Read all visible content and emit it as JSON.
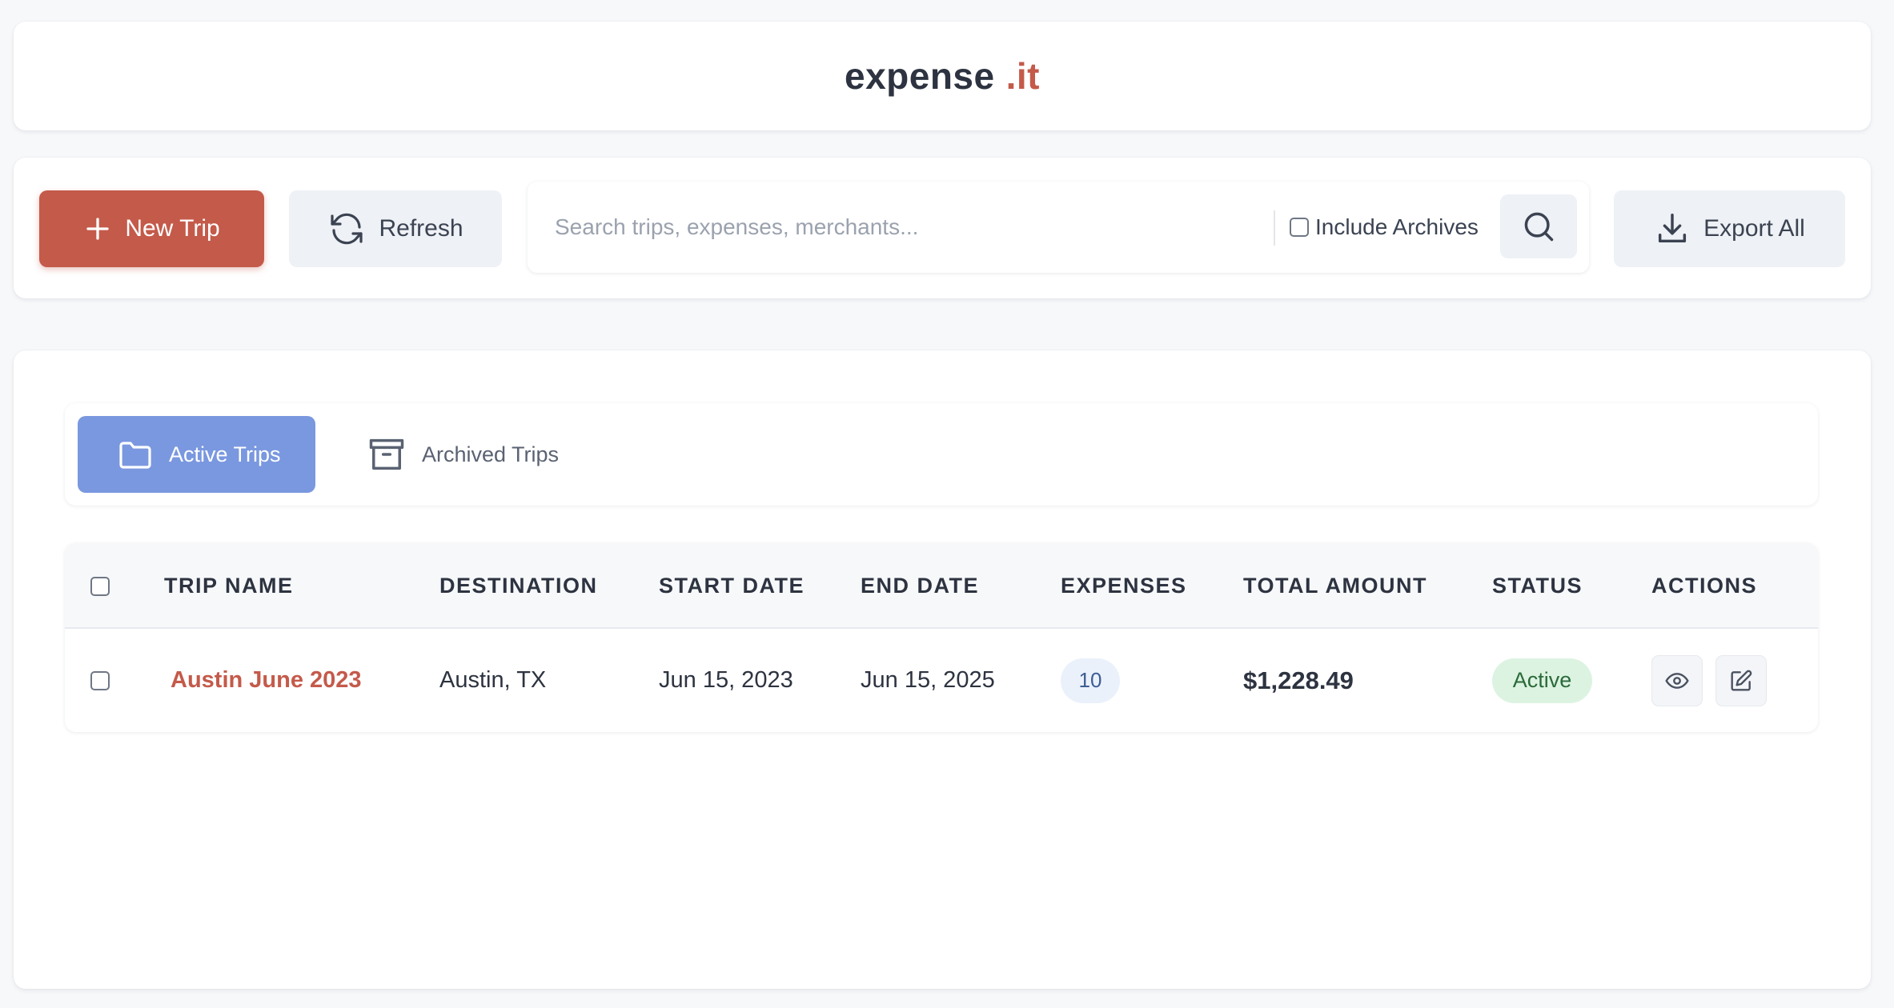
{
  "app": {
    "brand_name": "expense",
    "brand_tld": ".it",
    "accent_color": "#c45a4a"
  },
  "toolbar": {
    "new_trip_label": "New Trip",
    "refresh_label": "Refresh",
    "search_placeholder": "Search trips, expenses, merchants...",
    "search_value": "",
    "include_archives_label": "Include Archives",
    "include_archives_checked": false,
    "export_label": "Export All"
  },
  "tabs": [
    {
      "label": "Active Trips",
      "active": true,
      "icon": "folder-icon"
    },
    {
      "label": "Archived Trips",
      "active": false,
      "icon": "archive-icon"
    }
  ],
  "table": {
    "columns": [
      "TRIP NAME",
      "DESTINATION",
      "START DATE",
      "END DATE",
      "EXPENSES",
      "TOTAL AMOUNT",
      "STATUS",
      "ACTIONS"
    ],
    "rows": [
      {
        "trip_name": "Austin June 2023",
        "destination": "Austin, TX",
        "start_date": "Jun 15, 2023",
        "end_date": "Jun 15, 2025",
        "expenses": "10",
        "total_amount": "$1,228.49",
        "status": "Active",
        "actions": [
          "eye-icon",
          "edit-icon"
        ]
      }
    ]
  }
}
